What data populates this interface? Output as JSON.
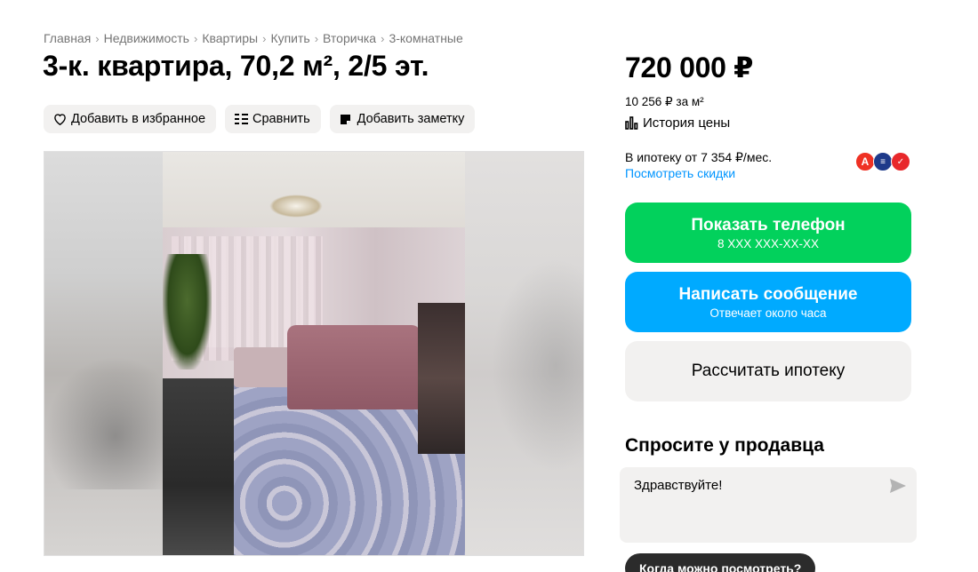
{
  "breadcrumb": {
    "items": [
      "Главная",
      "Недвижимость",
      "Квартиры",
      "Купить",
      "Вторичка",
      "3-комнатные"
    ],
    "separator": "›"
  },
  "listing": {
    "title": "3-к. квартира, 70,2 м², 2/5 эт."
  },
  "actions": {
    "favorite": "Добавить в избранное",
    "compare": "Сравнить",
    "note": "Добавить заметку"
  },
  "price": {
    "total": "720 000 ₽",
    "per_meter": "10 256 ₽ за м²",
    "history_label": "История цены"
  },
  "mortgage": {
    "text": "В ипотеку от 7 354 ₽/мес.",
    "discounts_link": "Посмотреть скидки",
    "banks": [
      "alfa-bank-icon",
      "bank-icon",
      "bank-icon"
    ]
  },
  "buttons": {
    "phone_label": "Показать телефон",
    "phone_sub": "8 XXX XXX-XX-XX",
    "message_label": "Написать сообщение",
    "message_sub": "Отвечает около часа",
    "mortgage_calc": "Рассчитать ипотеку"
  },
  "ask_seller": {
    "title": "Спросите у продавца",
    "input_value": "Здравствуйте!",
    "quick_question": "Когда можно посмотреть?"
  },
  "colors": {
    "green": "#02d15c",
    "blue": "#00aaff",
    "link": "#0095ff",
    "chip_bg": "#f2f1f0"
  }
}
